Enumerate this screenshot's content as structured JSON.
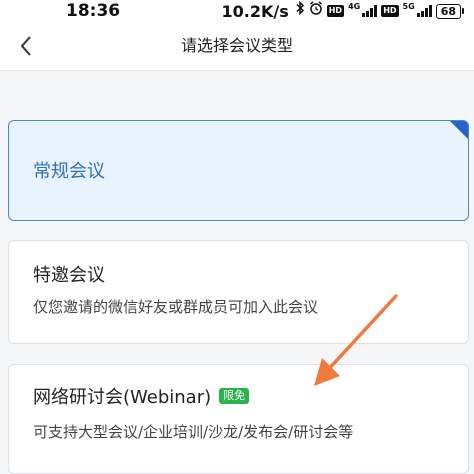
{
  "status_bar": {
    "time": "18:36",
    "net_speed": "10.2K/s",
    "hd1": "HD",
    "net1": "4G",
    "hd2": "HD",
    "net2": "5G",
    "battery": "68"
  },
  "header": {
    "title": "请选择会议类型"
  },
  "options": [
    {
      "title": "常规会议",
      "selected": true
    },
    {
      "title": "特邀会议",
      "description": "仅您邀请的微信好友或群成员可加入此会议"
    },
    {
      "title": "网络研讨会(Webinar)",
      "badge": "限免",
      "description": "可支持大型会议/企业培训/沙龙/发布会/研讨会等"
    }
  ],
  "colors": {
    "accent": "#2563c9",
    "selected_bg": "#e9f3fd",
    "badge_green": "#2bb24c",
    "annotation_arrow": "#f07a3c"
  }
}
